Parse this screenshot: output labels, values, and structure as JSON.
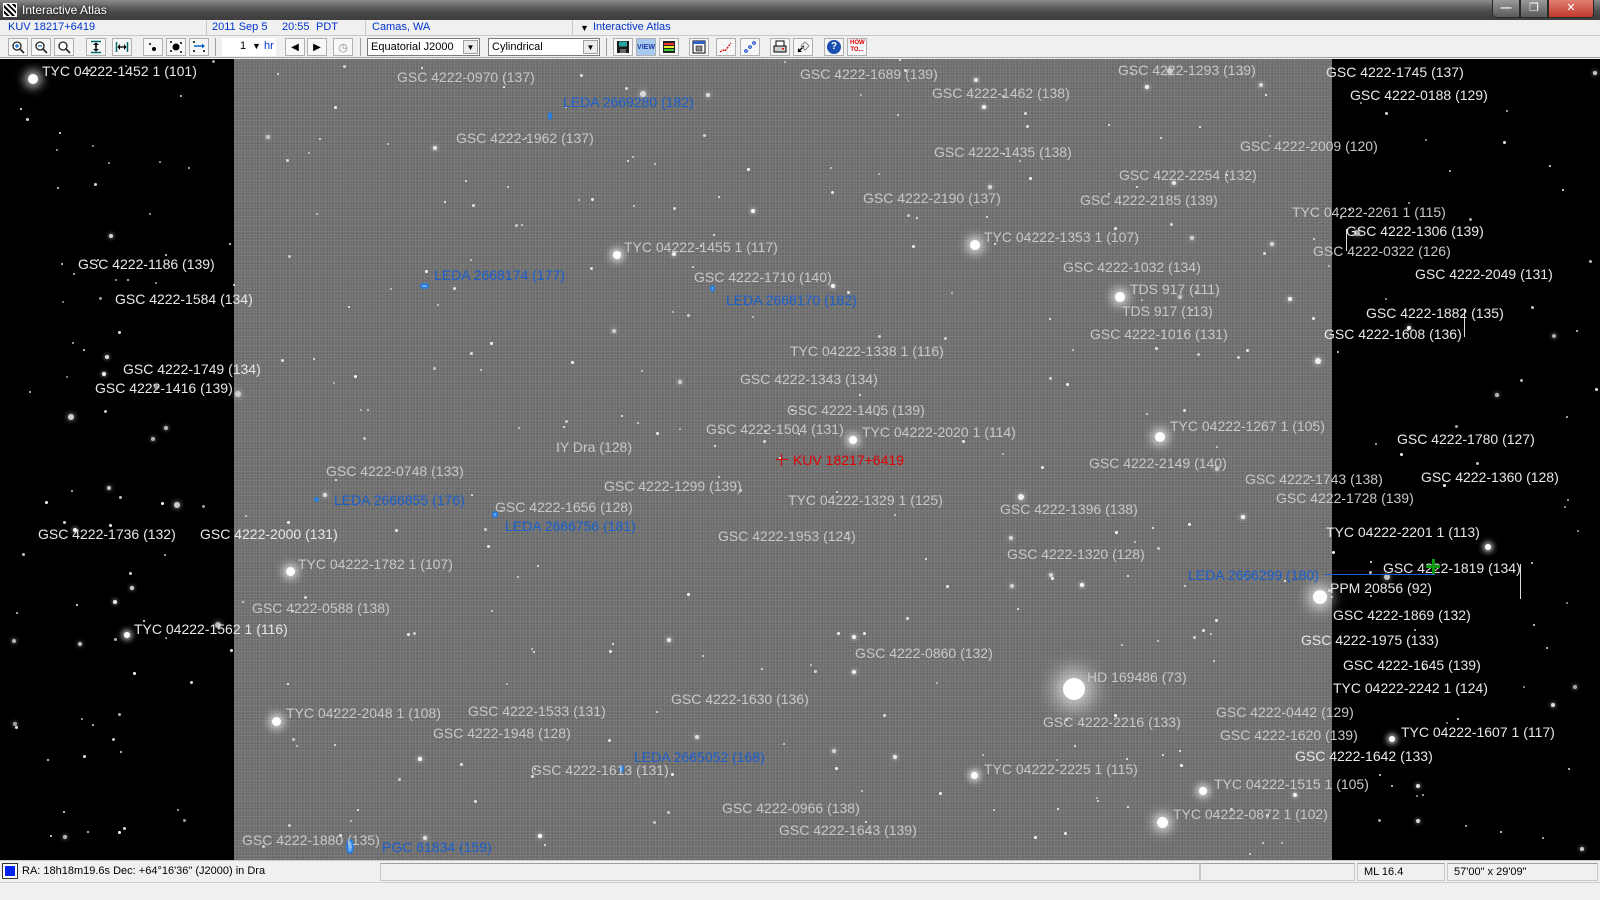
{
  "window": {
    "title": "Interactive Atlas",
    "controls": {
      "minimize": "minimize-icon",
      "restore": "restore-icon",
      "close": "close-icon"
    }
  },
  "infobar": {
    "object": "KUV 18217+6419",
    "date": "2011 Sep 5",
    "time": "20:55",
    "timezone": "PDT",
    "location": "Camas, WA",
    "mode": "Interactive Atlas"
  },
  "toolbar": {
    "buttons": [
      {
        "name": "zoom-in",
        "icon": "zoom-in-icon"
      },
      {
        "name": "zoom-out",
        "icon": "zoom-out-icon"
      },
      {
        "name": "zoom-reset",
        "icon": "magnifier-icon"
      },
      {
        "name": "fit-vertical",
        "icon": "fit-vertical-icon"
      },
      {
        "name": "fit-horizontal",
        "icon": "fit-horizontal-icon"
      },
      {
        "name": "fewer-stars",
        "icon": "fewer-stars-icon"
      },
      {
        "name": "more-stars",
        "icon": "more-stars-icon"
      },
      {
        "name": "flip",
        "icon": "flip-icon"
      },
      {
        "name": "step-back",
        "icon": "triangle-left-icon"
      },
      {
        "name": "step-forward",
        "icon": "triangle-right-icon"
      },
      {
        "name": "now",
        "icon": "clock-icon"
      },
      {
        "name": "save",
        "icon": "floppy-icon"
      },
      {
        "name": "view",
        "icon": "view-icon",
        "label": "VIEW"
      },
      {
        "name": "layers",
        "icon": "layers-icon"
      },
      {
        "name": "window",
        "icon": "window-icon"
      },
      {
        "name": "measure",
        "icon": "measure-icon"
      },
      {
        "name": "path",
        "icon": "path-icon"
      },
      {
        "name": "print",
        "icon": "printer-icon"
      },
      {
        "name": "pointer",
        "icon": "pointer-icon"
      },
      {
        "name": "help",
        "icon": "help-icon",
        "label": "?"
      },
      {
        "name": "how-to",
        "icon": "how-to-icon",
        "label": "HOW TO..."
      }
    ],
    "step_value": "1",
    "step_unit": "hr",
    "coordinate_system": "Equatorial J2000",
    "projection": "Cylindrical"
  },
  "labels": [
    {
      "text": "TYC 04222-1452 1 (101)",
      "color": "white"
    },
    {
      "text": "GSC 4222-0970 (137)",
      "color": "gray"
    },
    {
      "text": "LEDA 2669280 (182)",
      "color": "blue"
    },
    {
      "text": "GSC 4222-1962 (137)",
      "color": "gray"
    },
    {
      "text": "GSC 4222-1689 (139)",
      "color": "gray"
    },
    {
      "text": "GSC 4222-1462 (138)",
      "color": "gray"
    },
    {
      "text": "GSC 4222-1293 (139)",
      "color": "gray"
    },
    {
      "text": "GSC 4222-1745 (137)",
      "color": "white"
    },
    {
      "text": "GSC 4222-0188 (129)",
      "color": "white"
    },
    {
      "text": "GSC 4222-1435 (138)",
      "color": "gray"
    },
    {
      "text": "GSC 4222-2009 (120)",
      "color": "gray"
    },
    {
      "text": "GSC 4222-2254 (132)",
      "color": "gray"
    },
    {
      "text": "GSC 4222-2190 (137)",
      "color": "gray"
    },
    {
      "text": "GSC 4222-2185 (139)",
      "color": "gray"
    },
    {
      "text": "TYC 04222-2261 1 (115)",
      "color": "gray"
    },
    {
      "text": "GSC 4222-1306 (139)",
      "color": "white"
    },
    {
      "text": "TYC 04222-1353 1 (107)",
      "color": "gray"
    },
    {
      "text": "GSC 4222-0322 (126)",
      "color": "gray"
    },
    {
      "text": "TYC 04222-1455 1 (117)",
      "color": "gray"
    },
    {
      "text": "GSC 4222-1186 (139)",
      "color": "white"
    },
    {
      "text": "LEDA 2668174 (177)",
      "color": "blue"
    },
    {
      "text": "GSC 4222-1710 (140)",
      "color": "gray"
    },
    {
      "text": "GSC 4222-1032 (134)",
      "color": "gray"
    },
    {
      "text": "GSC 4222-2049 (131)",
      "color": "white"
    },
    {
      "text": "TDS 917 (111)",
      "color": "gray"
    },
    {
      "text": "GSC 4222-1584 (134)",
      "color": "white"
    },
    {
      "text": "LEDA 2668170 (182)",
      "color": "blue"
    },
    {
      "text": "TDS 917 (113)",
      "color": "gray"
    },
    {
      "text": "GSC 4222-1882 (135)",
      "color": "white"
    },
    {
      "text": "GSC 4222-1016 (131)",
      "color": "gray"
    },
    {
      "text": "GSC 4222-1608 (136)",
      "color": "white"
    },
    {
      "text": "TYC 04222-1338 1 (116)",
      "color": "gray"
    },
    {
      "text": "GSC 4222-1749 (134)",
      "color": "white"
    },
    {
      "text": "GSC 4222-1343 (134)",
      "color": "gray"
    },
    {
      "text": "GSC 4222-1416 (139)",
      "color": "white"
    },
    {
      "text": "GSC 4222-1405 (139)",
      "color": "gray"
    },
    {
      "text": "GSC 4222-1504 (131)",
      "color": "gray"
    },
    {
      "text": "TYC 04222-2020 1 (114)",
      "color": "gray"
    },
    {
      "text": "TYC 04222-1267 1 (105)",
      "color": "gray"
    },
    {
      "text": "GSC 4222-1780 (127)",
      "color": "white"
    },
    {
      "text": "IY Dra (128)",
      "color": "gray"
    },
    {
      "text": "KUV 18217+6419",
      "color": "red"
    },
    {
      "text": "GSC 4222-2149 (140)",
      "color": "gray"
    },
    {
      "text": "GSC 4222-0748 (133)",
      "color": "gray"
    },
    {
      "text": "GSC 4222-1360 (128)",
      "color": "white"
    },
    {
      "text": "GSC 4222-1743 (138)",
      "color": "gray"
    },
    {
      "text": "GSC 4222-1299 (139)",
      "color": "gray"
    },
    {
      "text": "LEDA 2666855 (176)",
      "color": "blue"
    },
    {
      "text": "TYC 04222-1329 1 (125)",
      "color": "gray"
    },
    {
      "text": "GSC 4222-1728 (139)",
      "color": "gray"
    },
    {
      "text": "GSC 4222-1656 (128)",
      "color": "gray"
    },
    {
      "text": "GSC 4222-1396 (138)",
      "color": "gray"
    },
    {
      "text": "LEDA 2666756 (181)",
      "color": "blue"
    },
    {
      "text": "GSC 4222-1736 (132)",
      "color": "white"
    },
    {
      "text": "GSC 4222-2000 (131)",
      "color": "white"
    },
    {
      "text": "TYC 04222-2201 1 (113)",
      "color": "white"
    },
    {
      "text": "GSC 4222-1953 (124)",
      "color": "gray"
    },
    {
      "text": "GSC 4222-1320 (128)",
      "color": "gray"
    },
    {
      "text": "TYC 04222-1782 1 (107)",
      "color": "gray"
    },
    {
      "text": "GSC 4222-1819 (134)",
      "color": "white"
    },
    {
      "text": "LEDA 2666299 (180)",
      "color": "blue"
    },
    {
      "text": "PPM 20856 (92)",
      "color": "white"
    },
    {
      "text": "GSC 4222-0588 (138)",
      "color": "gray"
    },
    {
      "text": "GSC 4222-1869 (132)",
      "color": "white"
    },
    {
      "text": "TYC 04222-1562 1 (116)",
      "color": "white"
    },
    {
      "text": "GSC 4222-1975 (133)",
      "color": "white"
    },
    {
      "text": "GSC 4222-0860 (132)",
      "color": "gray"
    },
    {
      "text": "GSC 4222-1645 (139)",
      "color": "white"
    },
    {
      "text": "HD 169486 (73)",
      "color": "gray"
    },
    {
      "text": "TYC 04222-2242 1 (124)",
      "color": "white"
    },
    {
      "text": "GSC 4222-1630 (136)",
      "color": "gray"
    },
    {
      "text": "TYC 04222-2048 1 (108)",
      "color": "gray"
    },
    {
      "text": "GSC 4222-1533 (131)",
      "color": "gray"
    },
    {
      "text": "GSC 4222-0442 (129)",
      "color": "gray"
    },
    {
      "text": "GSC 4222-2216 (133)",
      "color": "gray"
    },
    {
      "text": "GSC 4222-1948 (128)",
      "color": "gray"
    },
    {
      "text": "GSC 4222-1620 (139)",
      "color": "gray"
    },
    {
      "text": "TYC 04222-1607 1 (117)",
      "color": "white"
    },
    {
      "text": "GSC 4222-1642 (133)",
      "color": "white"
    },
    {
      "text": "LEDA 2665052 (168)",
      "color": "blue"
    },
    {
      "text": "TYC 04222-2225 1 (115)",
      "color": "gray"
    },
    {
      "text": "GSC 4222-1613 (131)",
      "color": "gray"
    },
    {
      "text": "TYC 04222-1515 1 (105)",
      "color": "gray"
    },
    {
      "text": "GSC 4222-0966 (138)",
      "color": "gray"
    },
    {
      "text": "TYC 04222-0872 1 (102)",
      "color": "gray"
    },
    {
      "text": "GSC 4222-1643 (139)",
      "color": "gray"
    },
    {
      "text": "GSC 4222-1880 (135)",
      "color": "gray"
    },
    {
      "text": "PGC 61834 (159)",
      "color": "blue"
    }
  ],
  "colors": {
    "label_gray": "#c8c8c8",
    "label_white": "#e8e8e8",
    "galaxy_blue": "#1a5fd0",
    "target_red": "#e00000",
    "cursor_green": "#0a9a0a",
    "plate_gray": "#6e6e6e"
  },
  "statusbar": {
    "position": "RA:  18h18m19.6s  Dec: +64°16'36\" (J2000) in Dra",
    "cell2": "",
    "cell3": "",
    "cell4": "",
    "limiting_magnitude": "ML 16.4",
    "field_of_view": "57'00\" x 29'09\""
  }
}
